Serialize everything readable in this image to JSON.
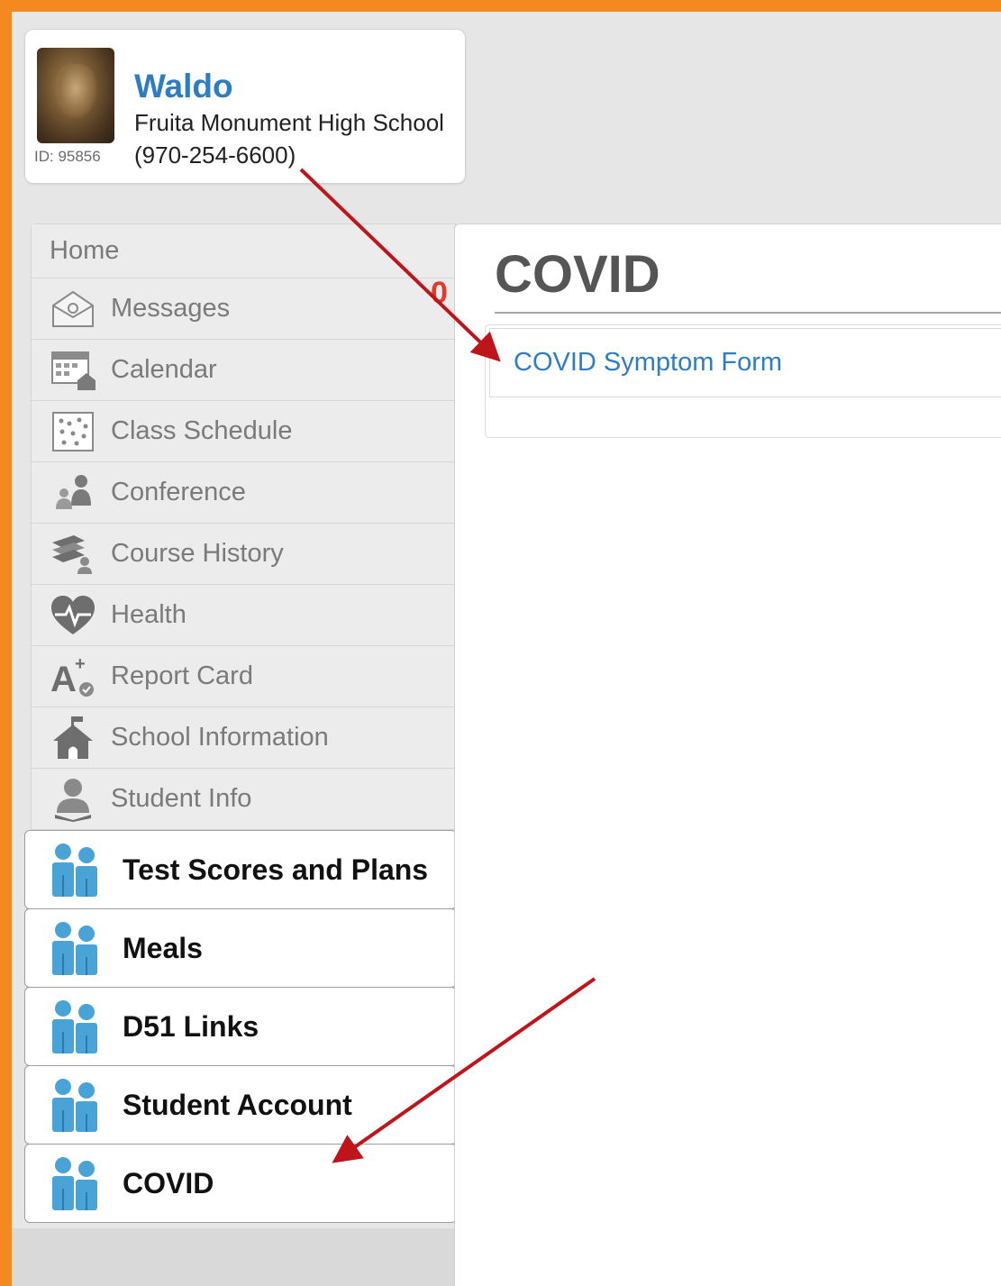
{
  "header": {
    "student_name": "Waldo",
    "school_name": "Fruita Monument High School",
    "school_phone": "(970-254-6600)",
    "student_id": "ID: 95856"
  },
  "sidebar": {
    "home_label": "Home",
    "message_count": "0",
    "items": [
      {
        "label": "Messages",
        "icon": "envelope-icon"
      },
      {
        "label": "Calendar",
        "icon": "calendar-icon"
      },
      {
        "label": "Class Schedule",
        "icon": "schedule-grid-icon"
      },
      {
        "label": "Conference",
        "icon": "conference-people-icon"
      },
      {
        "label": "Course History",
        "icon": "books-icon"
      },
      {
        "label": "Health",
        "icon": "heart-pulse-icon"
      },
      {
        "label": "Report Card",
        "icon": "report-card-grade-icon"
      },
      {
        "label": "School Information",
        "icon": "schoolhouse-icon"
      },
      {
        "label": "Student Info",
        "icon": "student-person-icon"
      }
    ],
    "tiles": [
      {
        "label": "Test Scores and Plans",
        "icon": "people-group-icon"
      },
      {
        "label": "Meals",
        "icon": "people-group-icon"
      },
      {
        "label": "D51 Links",
        "icon": "people-group-icon"
      },
      {
        "label": "Student Account",
        "icon": "people-group-icon"
      },
      {
        "label": "COVID",
        "icon": "people-group-icon"
      }
    ]
  },
  "main": {
    "title": "COVID",
    "links": [
      "COVID Symptom Form"
    ]
  },
  "colors": {
    "frame_orange": "#f4891f",
    "link_blue": "#2f7dc1",
    "arrow_red": "#c0141b",
    "tile_icon_blue": "#4aa3d6"
  }
}
